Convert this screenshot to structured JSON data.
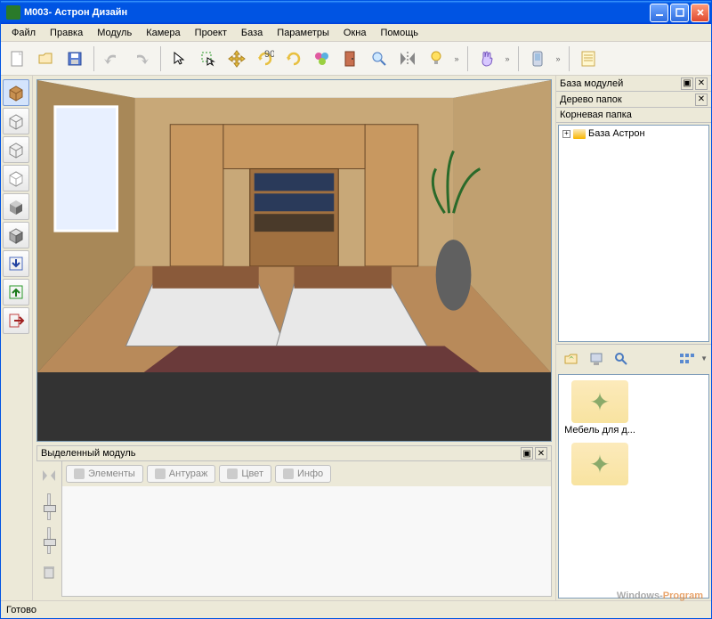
{
  "titlebar": {
    "text": "M003- Астрон Дизайн"
  },
  "menu": {
    "items": [
      "Файл",
      "Правка",
      "Модуль",
      "Камера",
      "Проект",
      "База",
      "Параметры",
      "Окна",
      "Помощь"
    ]
  },
  "toolbar": {
    "groups": [
      {
        "buttons": [
          "new-doc-icon",
          "open-icon",
          "save-icon"
        ]
      },
      {
        "buttons": [
          "undo-icon",
          "redo-icon"
        ]
      },
      {
        "buttons": [
          "select-icon",
          "select-rect-icon",
          "move-icon",
          "rotate90-icon",
          "rotate-icon",
          "palette-icon",
          "door-icon",
          "zoom-icon",
          "mirror-icon",
          "bulb-icon"
        ],
        "more": true
      },
      {
        "buttons": [
          "hand-icon"
        ],
        "more": true
      },
      {
        "buttons": [
          "phone-icon"
        ],
        "more": true
      },
      {
        "buttons": [
          "sheet-icon"
        ]
      }
    ]
  },
  "left_toolbar": {
    "buttons": [
      "cube-wood-icon",
      "cube-outline-icon",
      "cube-outline2-icon",
      "cube-outline3-icon",
      "cube-shaded-icon",
      "cube-shaded2-icon",
      "import-down-icon",
      "export-up-icon",
      "exit-right-icon"
    ]
  },
  "panels": {
    "selected_module": {
      "title": "Выделенный модуль",
      "tabs": [
        "Элементы",
        "Антураж",
        "Цвет",
        "Инфо"
      ]
    },
    "module_base": {
      "title": "База модулей"
    },
    "folder_tree": {
      "title": "Дерево папок",
      "root_label": "Корневая папка",
      "items": [
        {
          "label": "База Астрон",
          "expandable": true
        }
      ]
    },
    "browser": {
      "items": [
        {
          "label": "Мебель для д..."
        },
        {
          "label": ""
        }
      ]
    }
  },
  "status": {
    "text": "Готово"
  },
  "watermark": {
    "left": "Windows-",
    "right": "Program"
  },
  "colors": {
    "title_blue": "#0054e3",
    "panel_bg": "#ece9d8",
    "border": "#7f9db9"
  }
}
